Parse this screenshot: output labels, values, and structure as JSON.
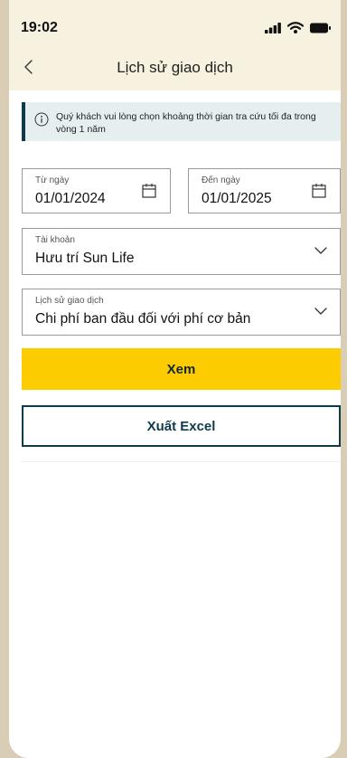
{
  "status_bar": {
    "time": "19:02"
  },
  "header": {
    "title": "Lịch sử giao dịch"
  },
  "notice": {
    "text": "Quý khách vui lòng chọn khoảng thời gian tra cứu tối đa trong vòng 1 năm"
  },
  "date_from": {
    "label": "Từ ngày",
    "value": "01/01/2024"
  },
  "date_to": {
    "label": "Đến ngày",
    "value": "01/01/2025"
  },
  "account": {
    "label": "Tài khoản",
    "value": "Hưu trí Sun Life"
  },
  "transaction_history": {
    "label": "Lịch sử giao dịch",
    "value": "Chi phí ban đầu đối với phí cơ bản"
  },
  "buttons": {
    "view": "Xem",
    "export": "Xuất Excel"
  },
  "colors": {
    "accent": "#fdcc00",
    "primary_dark": "#0e3a4c",
    "notice_bg": "#e5eff0"
  }
}
